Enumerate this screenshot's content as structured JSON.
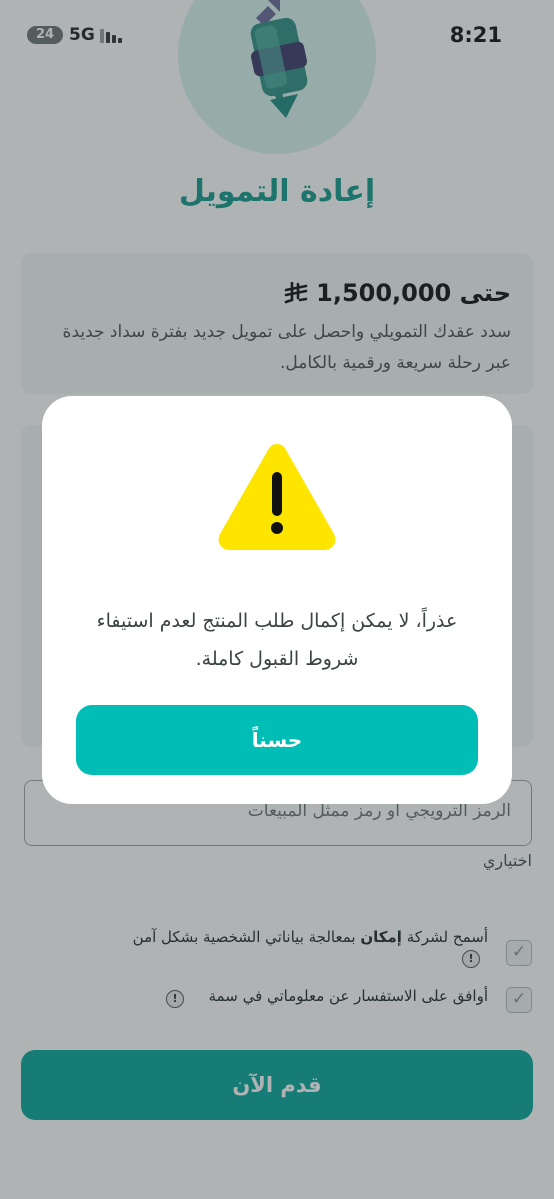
{
  "status_bar": {
    "battery": "24",
    "network": "5G",
    "time": "8:21"
  },
  "hero": {
    "icon": "refinance-arrows-icon",
    "title": "إعادة التمويل"
  },
  "info_card": {
    "amount_prefix": "حتى",
    "amount": "1,500,000",
    "currency_icon": "riyal-symbol-icon",
    "description": "سدد عقدك التمويلي واحصل على تمويل جديد بفترة سداد جديدة عبر رحلة سريعة ورقمية بالكامل."
  },
  "promo": {
    "placeholder": "الرمز الترويجي او رمز ممثل المبيعات",
    "optional_label": "اختياري"
  },
  "consents": [
    {
      "text_before": "أسمح لشركة ",
      "brand": "إمكان",
      "text_after": " بمعالجة بياناتي الشخصية بشكل آمن",
      "checked": true
    },
    {
      "text": "أوافق على الاستفسار عن معلوماتي في سمة",
      "checked": true
    }
  ],
  "submit_label": "قدم الآن",
  "modal": {
    "icon": "warning-icon",
    "message": "عذراً، لا يمكن إكمال طلب المنتج لعدم استيفاء شروط القبول كاملة.",
    "ok_label": "حسناً"
  },
  "colors": {
    "brand_teal": "#12998d",
    "button_teal": "#00bdb5",
    "warning_yellow": "#fde500"
  }
}
